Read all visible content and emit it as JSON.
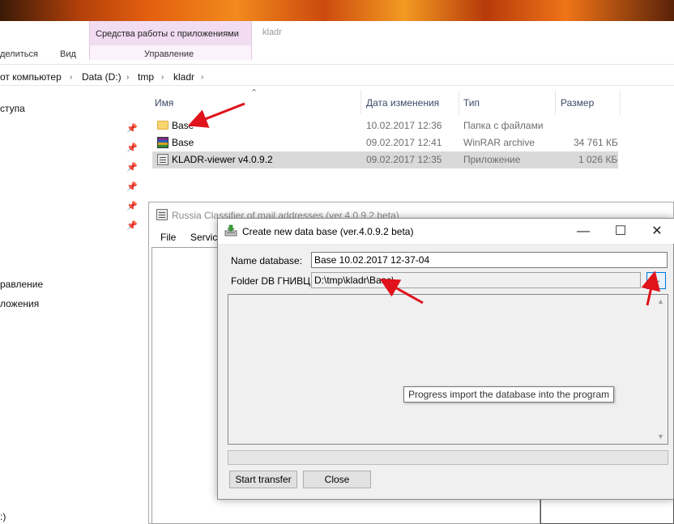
{
  "ribbon": {
    "share_tab": "делиться",
    "view_tab": "Вид",
    "context_group": "Средства работы с приложениями",
    "context_tab": "Управление",
    "window_title": "kladr"
  },
  "address": {
    "crumbs": [
      "от компьютер",
      "Data (D:)",
      "tmp",
      "kladr"
    ]
  },
  "navpane": {
    "items": [
      "ступа",
      "равление",
      "ложения",
      ":)"
    ]
  },
  "filelist": {
    "columns": {
      "name": "Имя",
      "modified": "Дата изменения",
      "type": "Тип",
      "size": "Размер"
    },
    "rows": [
      {
        "name": "Base",
        "modified": "10.02.2017 12:36",
        "type": "Папка с файлами",
        "size": "",
        "icon": "folder-icon"
      },
      {
        "name": "Base",
        "modified": "09.02.2017 12:41",
        "type": "WinRAR archive",
        "size": "34 761 КБ",
        "icon": "winrar-archive-icon"
      },
      {
        "name": "KLADR-viewer v4.0.9.2",
        "modified": "09.02.2017 12:35",
        "type": "Приложение",
        "size": "1 026 КБ",
        "icon": "application-icon"
      }
    ]
  },
  "backwin": {
    "title": "Russia Classifier of mail addresses   (ver.4.0.9.2 beta)",
    "menu": [
      "File",
      "Servic"
    ]
  },
  "dialog": {
    "title": "Create new data base   (ver.4.0.9.2 beta)",
    "name_label": "Name database:",
    "name_value": "Base 10.02.2017 12-37-04",
    "folder_label": "Folder DB ГНИВЦ:",
    "folder_value": "D:\\tmp\\kladr\\Base\\",
    "browse_label": "...",
    "start_label": "Start transfer",
    "close_label": "Close",
    "minimize_glyph": "—",
    "maximize_glyph": "☐",
    "close_glyph": "✕"
  },
  "tooltip": {
    "text": "Progress import the database into the program"
  },
  "colors": {
    "annotation_arrow": "#e0121b",
    "ribbon_context": "#f2dcf2",
    "selection": "#d9d9d9"
  }
}
